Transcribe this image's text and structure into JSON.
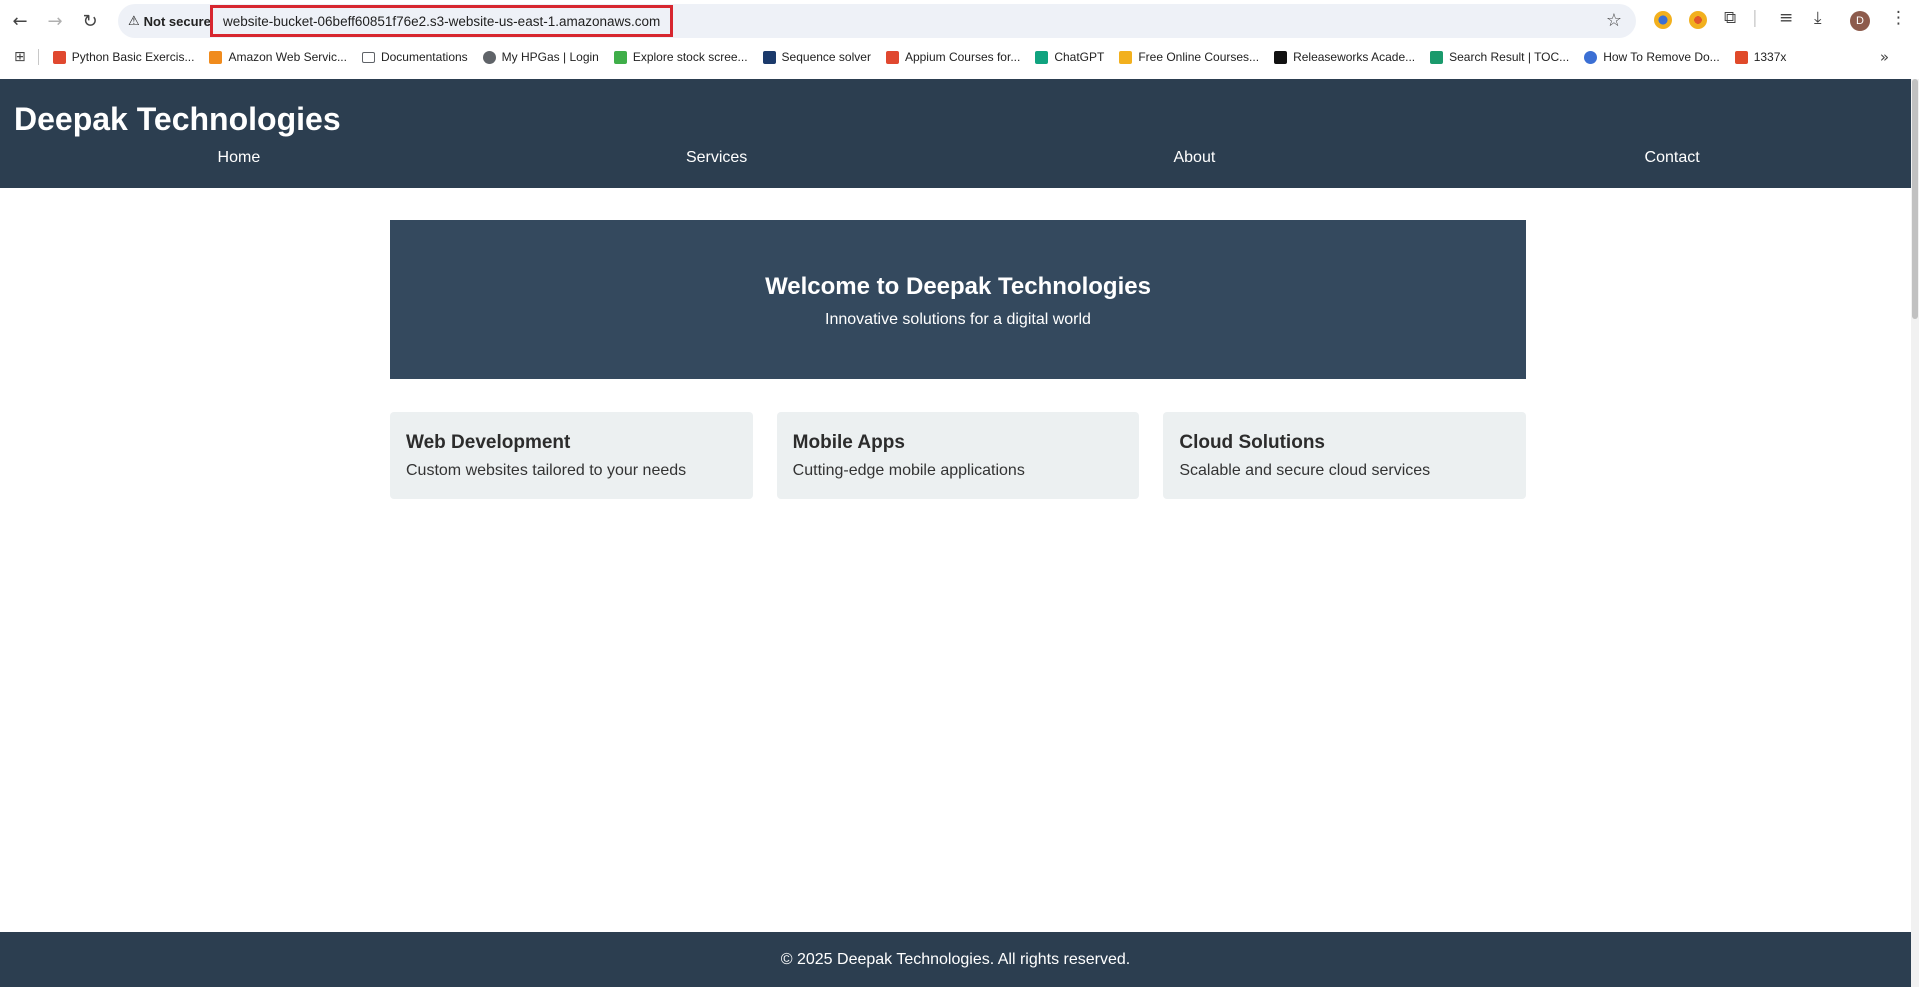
{
  "browser": {
    "security_label": "Not secure",
    "url": "website-bucket-06beff60851f76e2.s3-website-us-east-1.amazonaws.com",
    "avatar_letter": "D"
  },
  "bookmarks": [
    {
      "label": "Python Basic Exercis...",
      "icon": "python-favicon",
      "color": "#e0482f"
    },
    {
      "label": "Amazon Web Servic...",
      "icon": "aws-favicon",
      "color": "#f08b1d"
    },
    {
      "label": "Documentations",
      "icon": "folder-icon",
      "color": "#ffffff"
    },
    {
      "label": "My HPGas | Login",
      "icon": "globe-icon",
      "color": "#5f6368"
    },
    {
      "label": "Explore stock scree...",
      "icon": "chart-favicon",
      "color": "#3fae49"
    },
    {
      "label": "Sequence solver",
      "icon": "sequence-favicon",
      "color": "#1b3a6b"
    },
    {
      "label": "Appium Courses for...",
      "icon": "appium-favicon",
      "color": "#e0482f"
    },
    {
      "label": "ChatGPT",
      "icon": "chatgpt-favicon",
      "color": "#10a37f"
    },
    {
      "label": "Free Online Courses...",
      "icon": "courses-favicon",
      "color": "#f2b01e"
    },
    {
      "label": "Releaseworks Acade...",
      "icon": "releaseworks-favicon",
      "color": "#111111"
    },
    {
      "label": "Search Result | TOC...",
      "icon": "toc-favicon",
      "color": "#1a9a6c"
    },
    {
      "label": "How To Remove Do...",
      "icon": "globe-icon",
      "color": "#3b6fd4"
    },
    {
      "label": "1337x",
      "icon": "x-favicon",
      "color": "#e04a2a"
    }
  ],
  "site": {
    "title": "Deepak Technologies",
    "nav": [
      "Home",
      "Services",
      "About",
      "Contact"
    ],
    "hero": {
      "title": "Welcome to Deepak Technologies",
      "subtitle": "Innovative solutions for a digital world"
    },
    "cards": [
      {
        "title": "Web Development",
        "desc": "Custom websites tailored to your needs"
      },
      {
        "title": "Mobile Apps",
        "desc": "Cutting-edge mobile applications"
      },
      {
        "title": "Cloud Solutions",
        "desc": "Scalable and secure cloud services"
      }
    ],
    "footer": "© 2025 Deepak Technologies. All rights reserved."
  },
  "colors": {
    "header_bg": "#2c3e50",
    "hero_bg": "#34495e",
    "card_bg": "#ecf0f1",
    "url_highlight": "#d7262f"
  }
}
